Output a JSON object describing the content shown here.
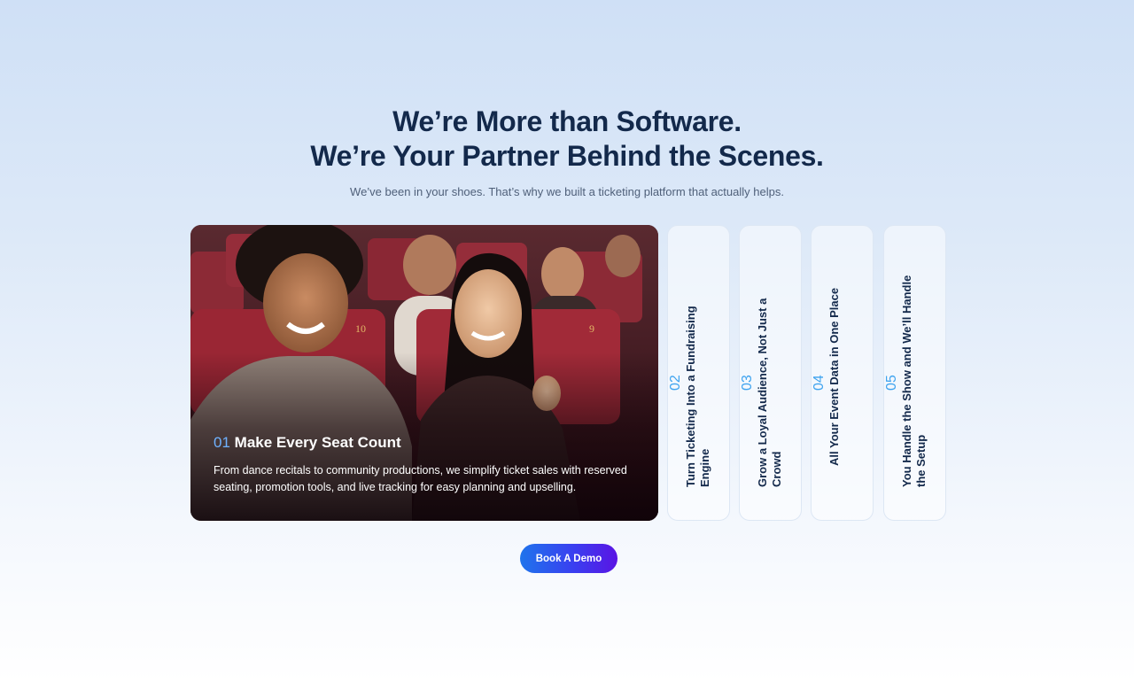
{
  "hero": {
    "headline_line1": "We’re More than Software.",
    "headline_line2": "We’re Your Partner Behind the Scenes.",
    "subtitle": "We’ve been in your shoes. That’s why we built a ticketing platform that actually helps."
  },
  "features": {
    "active": {
      "number": "01",
      "title": "Make Every Seat Count",
      "description": "From dance recitals to community productions, we simplify ticket sales with reserved seating, promotion tools, and live tracking for easy planning and upselling.",
      "image": "theater-audience-photo",
      "seat_labels": [
        "10",
        "9"
      ]
    },
    "tabs": [
      {
        "number": "02",
        "label": "Turn Ticketing Into a Fundraising Engine"
      },
      {
        "number": "03",
        "label": "Grow a Loyal Audience, Not Just a Crowd"
      },
      {
        "number": "04",
        "label": "All Your Event Data in One Place"
      },
      {
        "number": "05",
        "label": "You Handle the Show and We’ll Handle the Setup"
      }
    ]
  },
  "cta": {
    "label": "Book A Demo"
  },
  "colors": {
    "heading": "#13294b",
    "accent_number": "#3ea3ef",
    "button_start": "#1f74ec",
    "button_end": "#5a14e4"
  }
}
